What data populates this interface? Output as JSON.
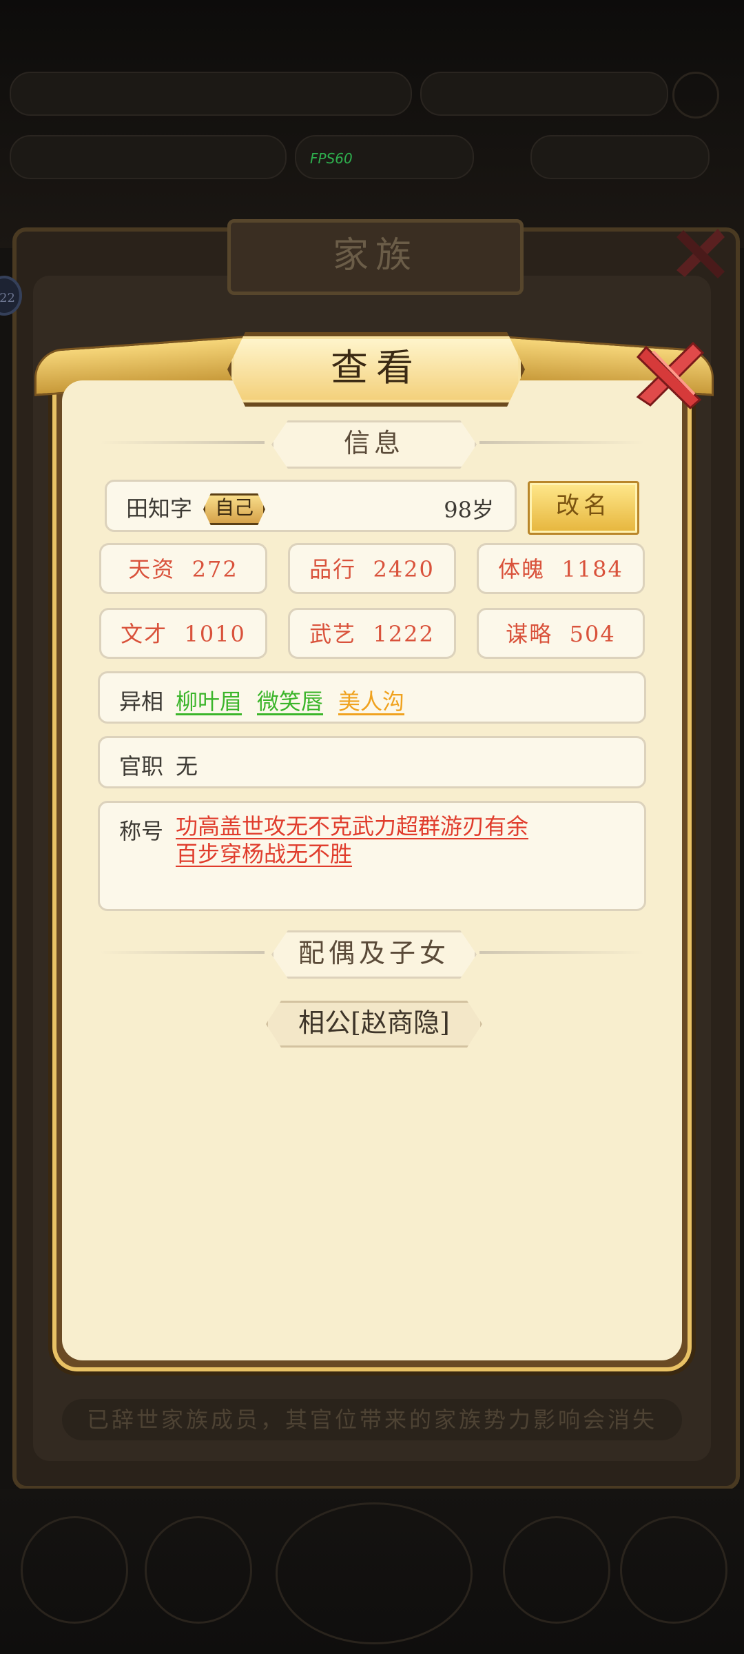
{
  "background": {
    "fps": "FPS60",
    "window_title": "家族",
    "side_badge": "22",
    "notice": "已辞世家族成员，其官位带来的家族势力影响会消失"
  },
  "dialog": {
    "title": "查看",
    "info_section": "信息",
    "name": "田知字",
    "self_tag": "自己",
    "age": "98岁",
    "rename_label": "改名",
    "stats": [
      {
        "label": "天资",
        "value": "272"
      },
      {
        "label": "品行",
        "value": "2420"
      },
      {
        "label": "体魄",
        "value": "1184"
      },
      {
        "label": "文才",
        "value": "1010"
      },
      {
        "label": "武艺",
        "value": "1222"
      },
      {
        "label": "谋略",
        "value": "504"
      }
    ],
    "appearance_label": "异相",
    "appearance_traits": [
      {
        "text": "柳叶眉",
        "color": "#3bb52a"
      },
      {
        "text": "微笑唇",
        "color": "#3bb52a"
      },
      {
        "text": "美人沟",
        "color": "#f0a21e"
      }
    ],
    "office_label": "官职",
    "office_value": "无",
    "honor_label": "称号",
    "honor_line1": "功高盖世攻无不克武力超群游刃有余",
    "honor_line2": "百步穿杨战无不胜",
    "honor_color": "#e03c2c",
    "family_section": "配偶及子女",
    "spouse_button": "相公[赵商隐]"
  }
}
